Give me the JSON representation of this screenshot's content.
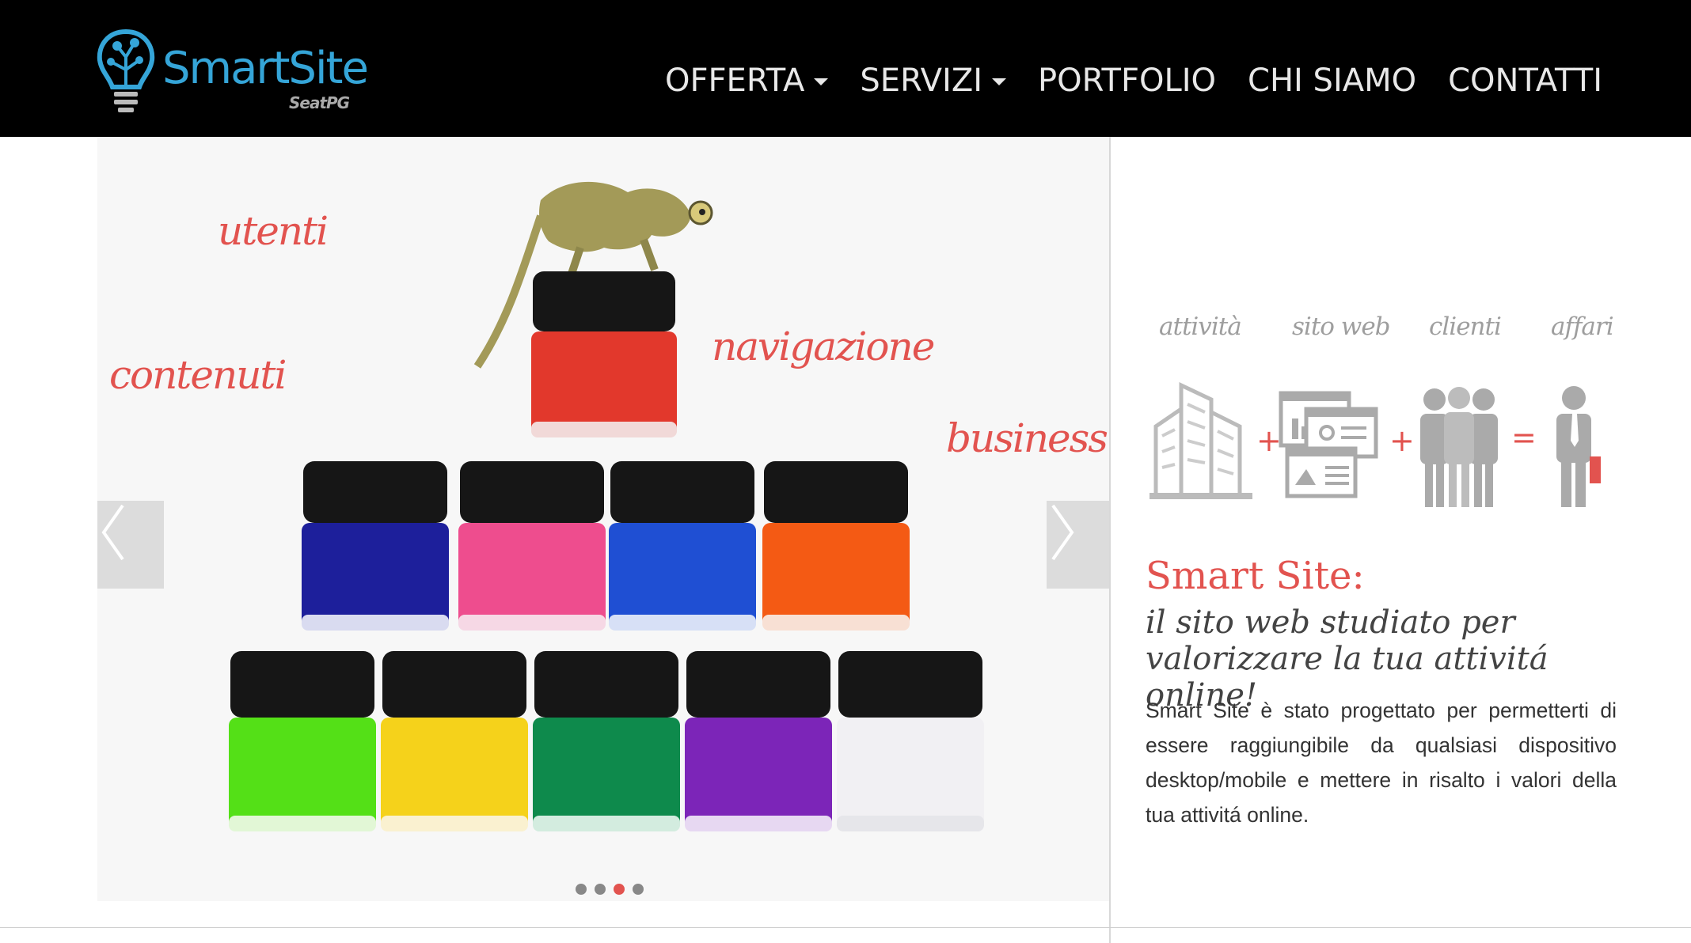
{
  "header": {
    "logo_text": "SmartSite",
    "logo_sub": "SeatPG",
    "nav": [
      {
        "label": "OFFERTA",
        "dropdown": true
      },
      {
        "label": "SERVIZI",
        "dropdown": true
      },
      {
        "label": "PORTFOLIO",
        "dropdown": false
      },
      {
        "label": "CHI SIAMO",
        "dropdown": false
      },
      {
        "label": "CONTATTI",
        "dropdown": false
      }
    ]
  },
  "slider": {
    "words": [
      "utenti",
      "contenuti",
      "navigazione",
      "business"
    ],
    "dots": 4,
    "active_dot": 3,
    "prev_icon": "chevron-left-icon",
    "next_icon": "chevron-right-icon"
  },
  "steps": {
    "labels": [
      "attività",
      "sito web",
      "clienti",
      "affari"
    ],
    "ops": [
      "+",
      "+",
      "="
    ],
    "icons": [
      "building-icon",
      "website-icon",
      "people-icon",
      "businessman-icon"
    ]
  },
  "intro": {
    "headline": "Smart Site:",
    "tagline_1": "il sito web studiato per",
    "tagline_2": "valorizzare la tua attivitá online!",
    "body": "Smart Site è stato progettato per permetterti di essere raggiungibile da qualsiasi dispositivo desktop/mobile e mettere in risalto i valori della tua attivitá online."
  },
  "colors": {
    "accent": "#e2534f",
    "logo_blue": "#35a5d8",
    "header_bg": "#000000"
  }
}
